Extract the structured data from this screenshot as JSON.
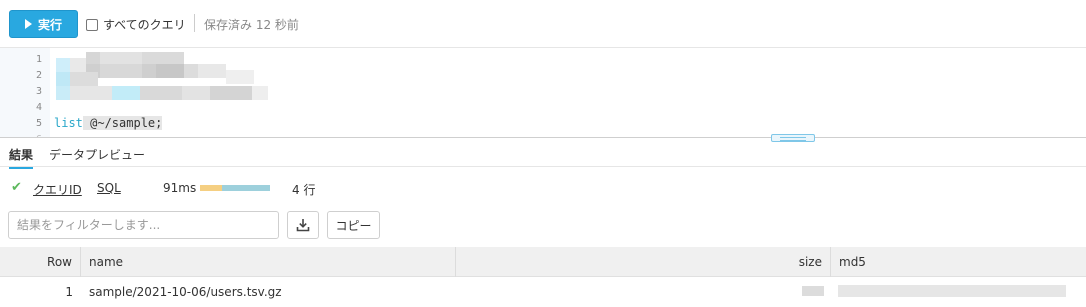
{
  "toolbar": {
    "run_label": "実行",
    "all_queries_label": "すべてのクエリ",
    "saved_status": "保存済み 12 秒前"
  },
  "editor": {
    "line_numbers": [
      "1",
      "2",
      "3",
      "4",
      "5"
    ],
    "line5_keyword": "list",
    "line5_rest": " @~/sample;"
  },
  "tabs": {
    "results": "結果",
    "data_preview": "データプレビュー"
  },
  "result_meta": {
    "query_id": "クエリID",
    "sql": "SQL",
    "duration": "91ms",
    "compile_fraction": 0.32,
    "row_count": "4 行"
  },
  "filter": {
    "placeholder": "結果をフィルターします..."
  },
  "actions": {
    "copy": "コピー"
  },
  "table": {
    "columns": [
      "Row",
      "name",
      "size",
      "md5"
    ],
    "rows": [
      {
        "row": "1",
        "name": "sample/2021-10-06/users.tsv.gz"
      }
    ]
  },
  "colors": {
    "accent": "#29a8e0",
    "success": "#5cb85c",
    "bar_compile": "#f5cf82",
    "bar_execute": "#9dd0dc"
  }
}
